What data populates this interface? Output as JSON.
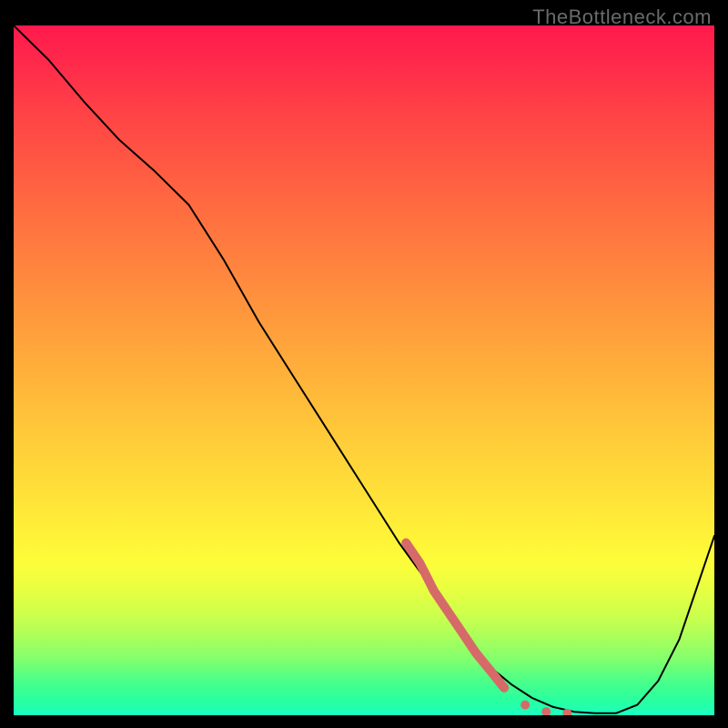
{
  "watermark": "TheBottleneck.com",
  "chart_data": {
    "type": "line",
    "title": "",
    "xlabel": "",
    "ylabel": "",
    "xlim": [
      0,
      100
    ],
    "ylim": [
      0,
      100
    ],
    "grid": false,
    "series": [
      {
        "name": "bottleneck-curve",
        "color": "#000000",
        "x": [
          0,
          5,
          10,
          15,
          20,
          25,
          30,
          35,
          40,
          45,
          50,
          55,
          60,
          63,
          65,
          68,
          71,
          74,
          77,
          80,
          83,
          86,
          89,
          92,
          95,
          100
        ],
        "values": [
          100,
          95,
          89,
          83.5,
          79,
          74,
          66,
          57,
          49,
          41,
          33,
          25,
          18,
          13,
          10,
          7,
          4.5,
          2.5,
          1.2,
          0.5,
          0.3,
          0.3,
          1.5,
          5,
          11,
          26
        ]
      },
      {
        "name": "highlight-segment",
        "color": "#d66a68",
        "style": "thick-dash-tail",
        "x": [
          56,
          58,
          60,
          62,
          64,
          66,
          68,
          70,
          73,
          76,
          79
        ],
        "values": [
          25,
          22,
          18,
          15,
          12,
          9,
          6.5,
          4,
          1.5,
          0.5,
          0.3
        ]
      }
    ],
    "background_gradient": {
      "top": "#ff1a4d",
      "mid": "#ffe138",
      "bottom": "#1affc2"
    }
  }
}
